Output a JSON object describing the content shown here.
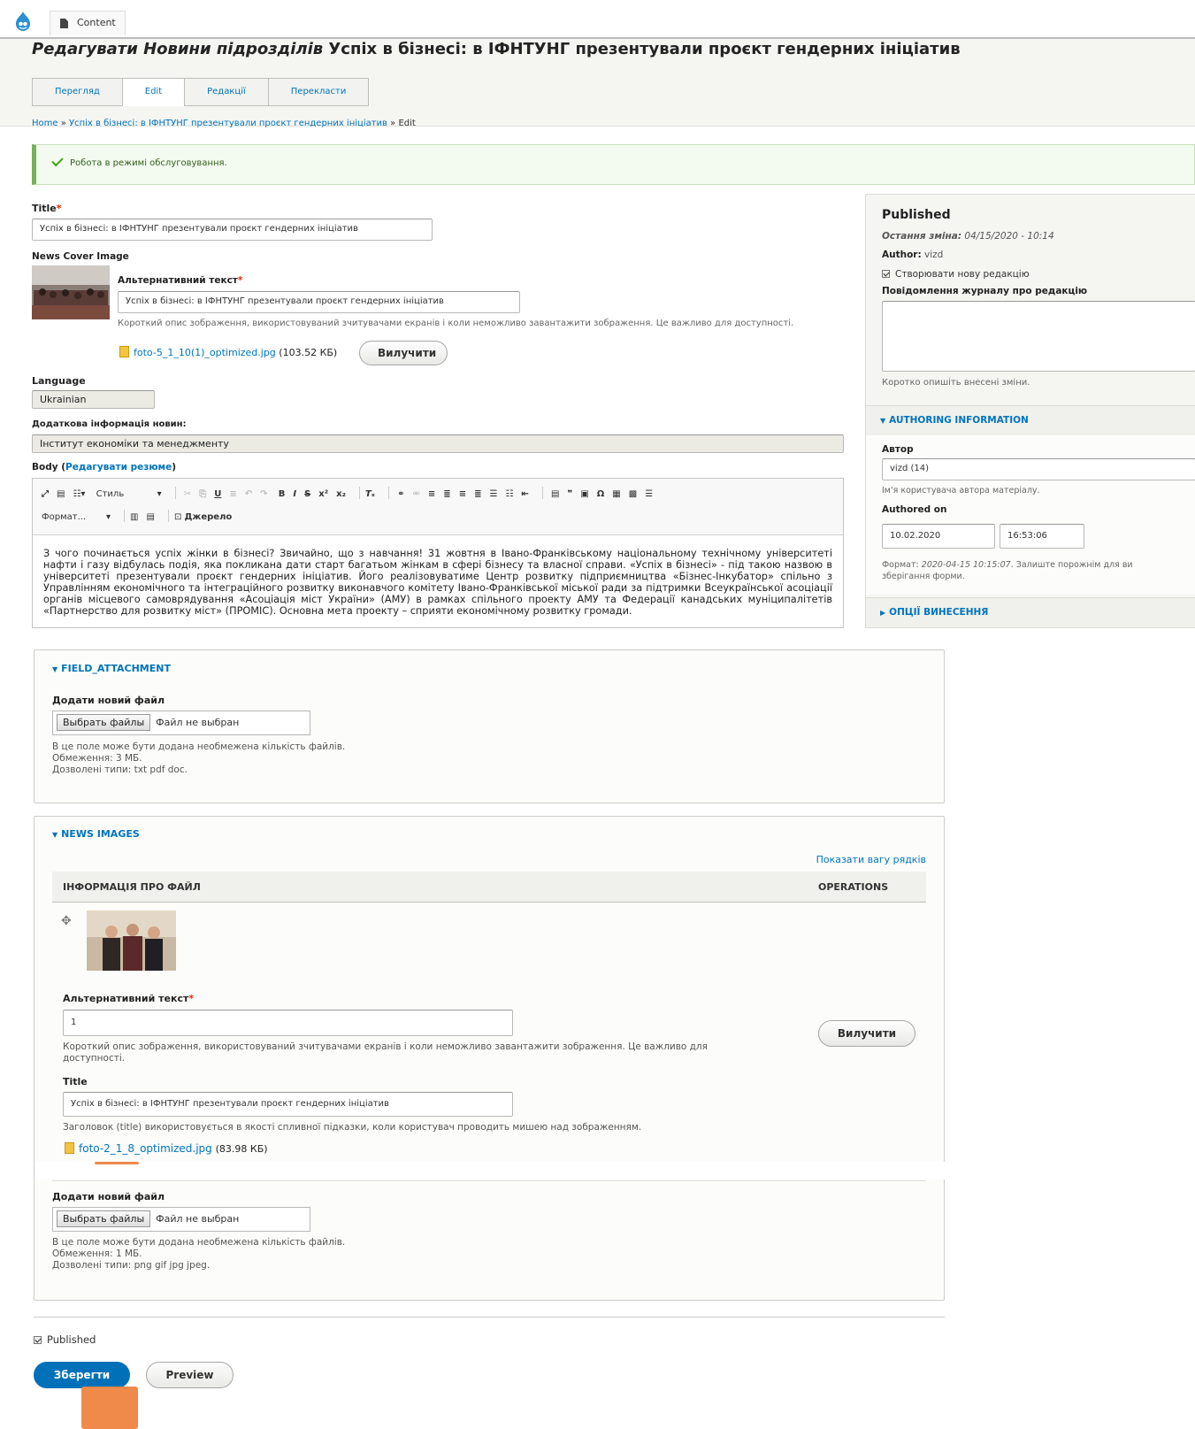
{
  "toolbar": {
    "content_label": "Content"
  },
  "page_title": {
    "prefix": "Редагувати Новини підрозділів",
    "node": "Успіх в бізнесі: в ІФНТУНГ презентували проєкт гендерних ініціатив"
  },
  "tabs": [
    "Перегляд",
    "Edit",
    "Редакції",
    "Перекласти"
  ],
  "breadcrumb": {
    "home": "Home",
    "node": "Успіх в бізнесі: в ІФНТУНГ презентували проєкт гендерних ініціатив",
    "sep": " » ",
    "current": "Edit"
  },
  "status_message": "Робота в режимі обслуговування.",
  "form": {
    "title_label": "Title",
    "title_value": "Успіх в бізнесі: в ІФНТУНГ презентували проєкт гендерних ініціатив",
    "cover_label": "News Cover Image",
    "alt_label": "Альтернативний текст",
    "alt_value": "Успіх в бізнесі: в ІФНТУНГ презентували проєкт гендерних ініціатив",
    "alt_desc": "Короткий опис зображення, використовуваний зчитувачами екранів і коли неможливо завантажити зображення. Це важливо для доступності.",
    "cover_file": "foto-5_1_10(1)_optimized.jpg",
    "cover_size": "(103.52 КБ)",
    "remove_label": "Вилучити",
    "language_label": "Language",
    "language_value": "Ukrainian",
    "extra_label": "Додаткова інформація новин:",
    "extra_value": "Інститут економіки та менеджменту",
    "body_label": "Body",
    "body_link": "Редагувати резюме",
    "format_label": "Формат...",
    "style_label": "Стиль",
    "source_label": "Джерело",
    "body_text": "З чого починається успіх жінки в бізнесі? Звичайно, що з навчання! 31 жовтня в Івано-Франківському національному технічному університеті нафти і газу відбулась подія, яка покликана дати старт багатьом жінкам в сфері бізнесу та власної справи. «Успіх в бізнесі» - під такою назвою в університеті презентували проєкт гендерних ініціатив. Його реалізовуватиме Центр розвитку підприємництва «Бізнес-Інкубатор» спільно з Управлінням економічного та інтеграційного розвитку виконавчого комітету Івано-Франківської міської ради за підтримки Всеукраїнської асоціації органів місцевого самоврядування «Асоціація міст України» (АМУ) в рамках спільного проекту АМУ та Федерації канадських муніципалітетів «Партнерство для розвитку міст» (ПРОМІС). Основна мета проекту – сприяти економічному розвитку громади."
  },
  "sidebar": {
    "published_title": "Published",
    "last_change_label": "Остання зміна:",
    "last_change_value": "04/15/2020 - 10:14",
    "author_label": "Author:",
    "author_value": "vizd",
    "new_revision": "Створювати нову редакцію",
    "log_label": "Повідомлення журналу про редакцію",
    "log_desc": "Коротко опишіть внесені зміни.",
    "authoring_title": "AUTHORING INFORMATION",
    "autor_label": "Автор",
    "autor_value": "vizd (14)",
    "autor_desc": "Ім'я користувача автора матеріалу.",
    "authored_on_label": "Authored on",
    "date_value": "10.02.2020",
    "time_value": "16:53:06",
    "format_desc_prefix": "Формат:",
    "format_desc_value": "2020-04-15 10:15:07",
    "format_desc_suffix": ". Залиште порожнім для ви",
    "format_desc_line2": "зберігання форми.",
    "options_title": "ОПЦІЇ ВИНЕСЕННЯ"
  },
  "attachment": {
    "legend": "FIELD_ATTACHMENT",
    "add_label": "Додати новий файл",
    "choose_btn": "Выбрать файлы",
    "no_file": "Файл не выбран",
    "desc1": "В це поле може бути додана необмежена кількість файлів.",
    "desc2": "Обмеження: 3 МБ.",
    "desc3": "Дозволені типи: txt pdf doc."
  },
  "news_images": {
    "legend": "NEWS IMAGES",
    "show_weights": "Показати вагу рядків",
    "col_info": "ІНФОРМАЦІЯ ПРО ФАЙЛ",
    "col_ops": "OPERATIONS",
    "alt_label": "Альтернативний текст",
    "alt_value": "1",
    "alt_desc1": "Короткий опис зображення, використовуваний зчитувачами екранів і коли неможливо завантажити зображення. Це важливо для",
    "alt_desc2": "доступності.",
    "title_label": "Title",
    "title_value": "Успіх в бізнесі: в ІФНТУНГ презентували проєкт гендерних ініціатив",
    "title_desc": "Заголовок (title) використовується в якості спливної підказки, коли користувач проводить мишею над зображенням.",
    "file_name": "foto-2_1_8_optimized.jpg",
    "file_size": "(83.98 КБ)",
    "remove_label": "Вилучити",
    "add_label": "Додати новий файл",
    "choose_btn": "Выбрать файлы",
    "no_file": "Файл не выбран",
    "desc1": "В це поле може бути додана необмежена кількість файлів.",
    "desc2": "Обмеження: 1 МБ.",
    "desc3": "Дозволені типи: png gif jpg jpeg."
  },
  "footer": {
    "published_label": "Published",
    "save_label": "Зберегти",
    "preview_label": "Preview"
  }
}
